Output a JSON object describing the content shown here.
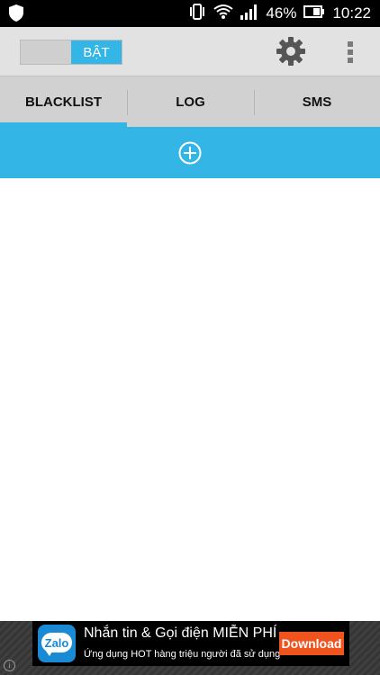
{
  "status_bar": {
    "battery_percent": "46%",
    "time": "10:22",
    "icons": [
      "shield-icon",
      "vibrate-icon",
      "wifi-icon",
      "signal-icon",
      "battery-icon"
    ]
  },
  "toolbar": {
    "toggle_label": "BẬT",
    "toggle_on": true,
    "icons": [
      "settings-gear-icon",
      "overflow-menu-icon"
    ]
  },
  "tabs": [
    {
      "label": "BLACKLIST",
      "selected": true
    },
    {
      "label": "LOG",
      "selected": false
    },
    {
      "label": "SMS",
      "selected": false
    }
  ],
  "add_bar": {
    "icon": "add-circle-icon"
  },
  "ad": {
    "logo_text": "Zalo",
    "headline": "Nhắn tin & Gọi điện MIỄN PHÍ",
    "subline": "Ứng dụng HOT hàng triệu người đã sử dụng",
    "button_label": "Download",
    "info_glyph": "i"
  },
  "colors": {
    "accent": "#33b5e5",
    "toolbar_bg": "#e2e2e2",
    "tabs_bg": "#d1d1d1",
    "ad_button": "#f0541e",
    "zalo_blue": "#1a8ad5"
  }
}
